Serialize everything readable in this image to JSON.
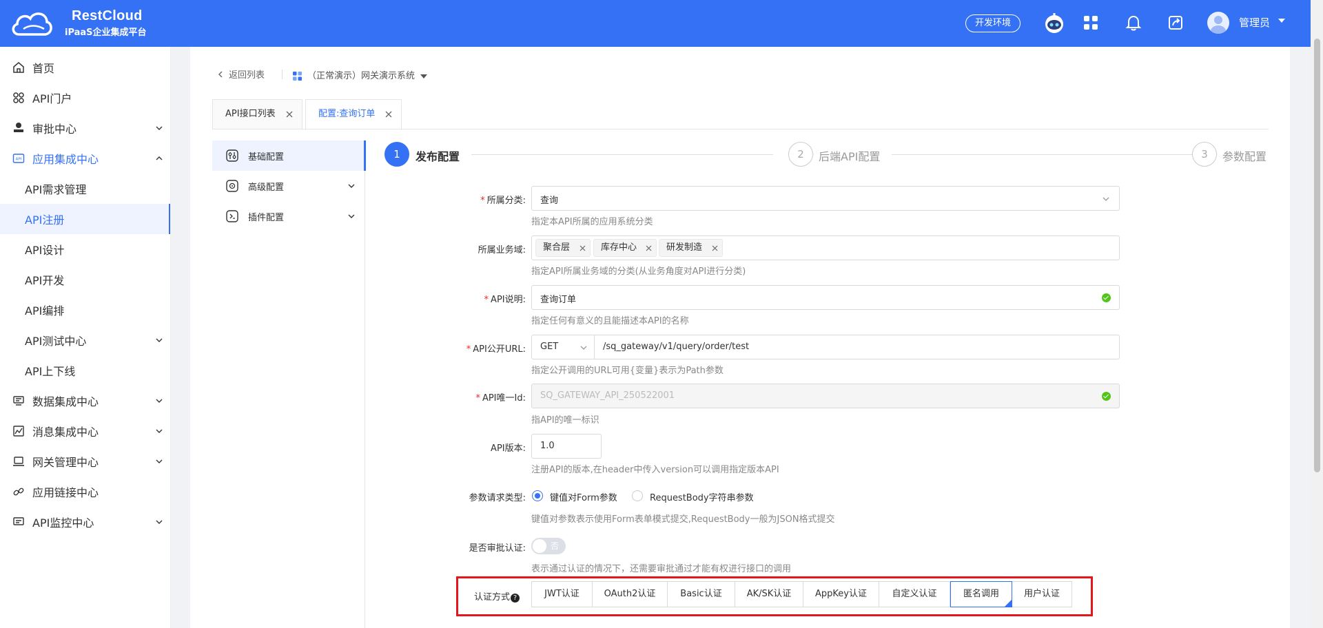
{
  "header": {
    "brand_name": "RestCloud",
    "brand_sub": "iPaaS企业集成平台",
    "env_badge": "开发环境",
    "user_name": "管理员",
    "brand_color": "#3471f4"
  },
  "sidebar": {
    "items": [
      {
        "label": "首页",
        "icon": "home-icon"
      },
      {
        "label": "API门户",
        "icon": "portal-icon"
      },
      {
        "label": "审批中心",
        "icon": "approval-icon"
      },
      {
        "label": "应用集成中心",
        "icon": "api-icon"
      },
      {
        "label": "API需求管理"
      },
      {
        "label": "API注册"
      },
      {
        "label": "API设计"
      },
      {
        "label": "API开发"
      },
      {
        "label": "API编排"
      },
      {
        "label": "API测试中心"
      },
      {
        "label": "API上下线"
      },
      {
        "label": "数据集成中心",
        "icon": "data-icon"
      },
      {
        "label": "消息集成中心",
        "icon": "message-icon"
      },
      {
        "label": "网关管理中心",
        "icon": "gateway-icon"
      },
      {
        "label": "应用链接中心",
        "icon": "link-icon"
      },
      {
        "label": "API监控中心",
        "icon": "monitor-icon"
      }
    ]
  },
  "breadcrumb": {
    "back_label": "返回列表",
    "system_label": "（正常演示）网关演示系统"
  },
  "tabs": [
    {
      "label": "API接口列表"
    },
    {
      "label": "配置:查询订单"
    }
  ],
  "subnav": [
    {
      "label": "基础配置",
      "icon": "basic-config-icon"
    },
    {
      "label": "高级配置",
      "icon": "advanced-config-icon"
    },
    {
      "label": "插件配置",
      "icon": "plugin-config-icon"
    }
  ],
  "steps": [
    {
      "num": "1",
      "label": "发布配置"
    },
    {
      "num": "2",
      "label": "后端API配置"
    },
    {
      "num": "3",
      "label": "参数配置"
    }
  ],
  "form": {
    "category": {
      "label": "所属分类:",
      "value": "查询",
      "help": "指定本API所属的应用系统分类"
    },
    "domain": {
      "label": "所属业务域:",
      "tags": [
        "聚合层",
        "库存中心",
        "研发制造"
      ],
      "help": "指定API所属业务域的分类(从业务角度对API进行分类)"
    },
    "desc": {
      "label": "API说明:",
      "value": "查询订单",
      "help": "指定任何有意义的且能描述本API的名称"
    },
    "url": {
      "label": "API公开URL:",
      "method": "GET",
      "value": "/sq_gateway/v1/query/order/test",
      "help": "指定公开调用的URL可用{变量}表示为Path参数"
    },
    "uid": {
      "label": "API唯一Id:",
      "value": "SQ_GATEWAY_API_250522001",
      "help": "指API的唯一标识"
    },
    "version": {
      "label": "API版本:",
      "value": "1.0",
      "help": "注册API的版本,在header中传入version可以调用指定版本API"
    },
    "param_type": {
      "label": "参数请求类型:",
      "option1": "键值对Form参数",
      "option2": "RequestBody字符串参数",
      "help": "键值对参数表示使用Form表单模式提交,RequestBody一般为JSON格式提交"
    },
    "approval": {
      "label": "是否审批认证:",
      "toggle_text": "否",
      "help": "表示通过认证的情况下，还需要审批通过才能有权进行接口的调用"
    },
    "auth": {
      "label": "认证方式",
      "help_mark": "?",
      "options": [
        "JWT认证",
        "OAuth2认证",
        "Basic认证",
        "AK/SK认证",
        "AppKey认证",
        "自定义认证",
        "匿名调用",
        "用户认证"
      ],
      "selected": "匿名调用",
      "highlight_color": "#e5151b"
    }
  }
}
